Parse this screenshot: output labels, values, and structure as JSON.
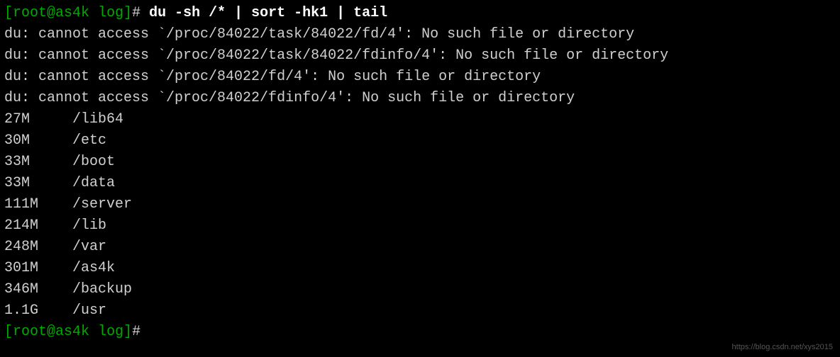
{
  "prompt1": {
    "bracket_open": "[",
    "user_host": "root@as4k",
    "cwd": "log",
    "bracket_close": "]",
    "hash": "# ",
    "command": "du -sh /* | sort -hk1 | tail"
  },
  "errors": [
    "du: cannot access `/proc/84022/task/84022/fd/4': No such file or directory",
    "du: cannot access `/proc/84022/task/84022/fdinfo/4': No such file or directory",
    "du: cannot access `/proc/84022/fd/4': No such file or directory",
    "du: cannot access `/proc/84022/fdinfo/4': No such file or directory"
  ],
  "results": [
    {
      "size": "27M",
      "path": "/lib64"
    },
    {
      "size": "30M",
      "path": "/etc"
    },
    {
      "size": "33M",
      "path": "/boot"
    },
    {
      "size": "33M",
      "path": "/data"
    },
    {
      "size": "111M",
      "path": "/server"
    },
    {
      "size": "214M",
      "path": "/lib"
    },
    {
      "size": "248M",
      "path": "/var"
    },
    {
      "size": "301M",
      "path": "/as4k"
    },
    {
      "size": "346M",
      "path": "/backup"
    },
    {
      "size": "1.1G",
      "path": "/usr"
    }
  ],
  "prompt2": {
    "bracket_open": "[",
    "user_host": "root@as4k",
    "cwd": "log",
    "bracket_close": "]",
    "hash": "# "
  },
  "watermark": "https://blog.csdn.net/xys2015"
}
